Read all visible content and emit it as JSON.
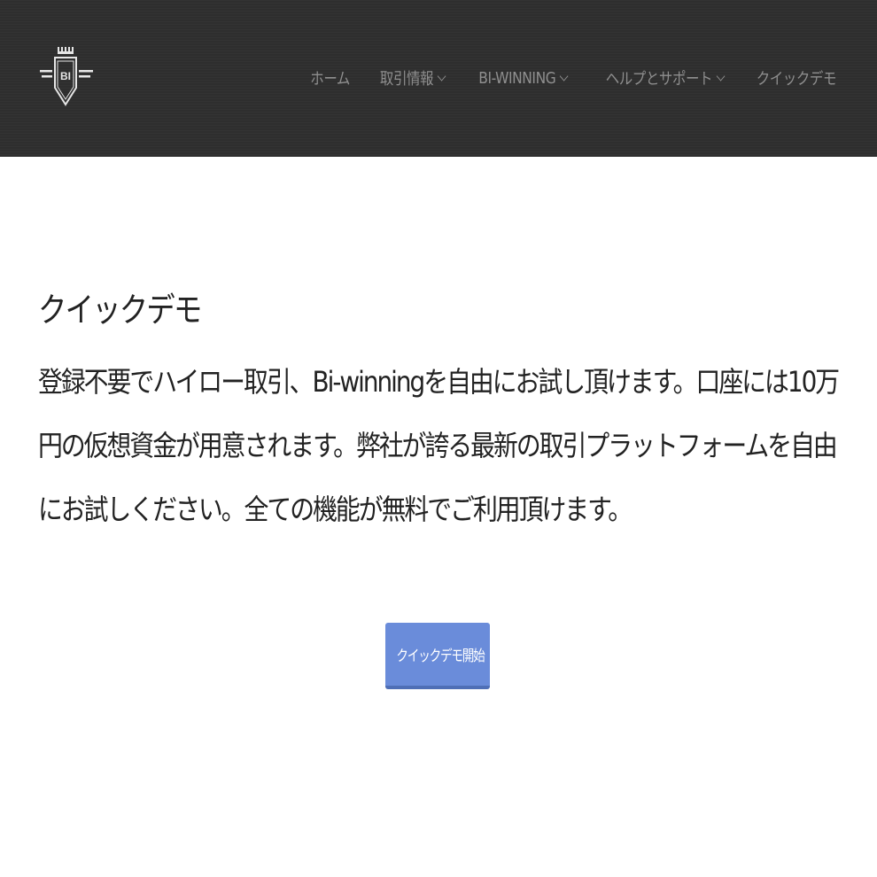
{
  "header": {
    "logo": {
      "icon": "bi-crown-shield-logo",
      "text": "BI"
    },
    "nav": [
      {
        "label": "ホーム",
        "has_dropdown": false
      },
      {
        "label": "取引情報",
        "has_dropdown": true
      },
      {
        "label": "BI-WINNING",
        "has_dropdown": true
      },
      {
        "label": "ヘルプとサポート",
        "has_dropdown": true
      },
      {
        "label": "クイックデモ",
        "has_dropdown": false
      }
    ]
  },
  "main": {
    "title": "クイックデモ",
    "description": "登録不要でハイロー取引、Bi-winningを自由にお試し頂けます。口座には10万円の仮想資金が用意されます。弊社が誇る最新の取引プラットフォームを自由にお試しください。全ての機能が無料でご利用頂けます。",
    "cta_label": "クイックデモ開始"
  },
  "colors": {
    "header_bg": "#2e2e2e",
    "nav_text": "#8f8f8f",
    "button_bg": "#6a8cda",
    "text": "#222222"
  }
}
